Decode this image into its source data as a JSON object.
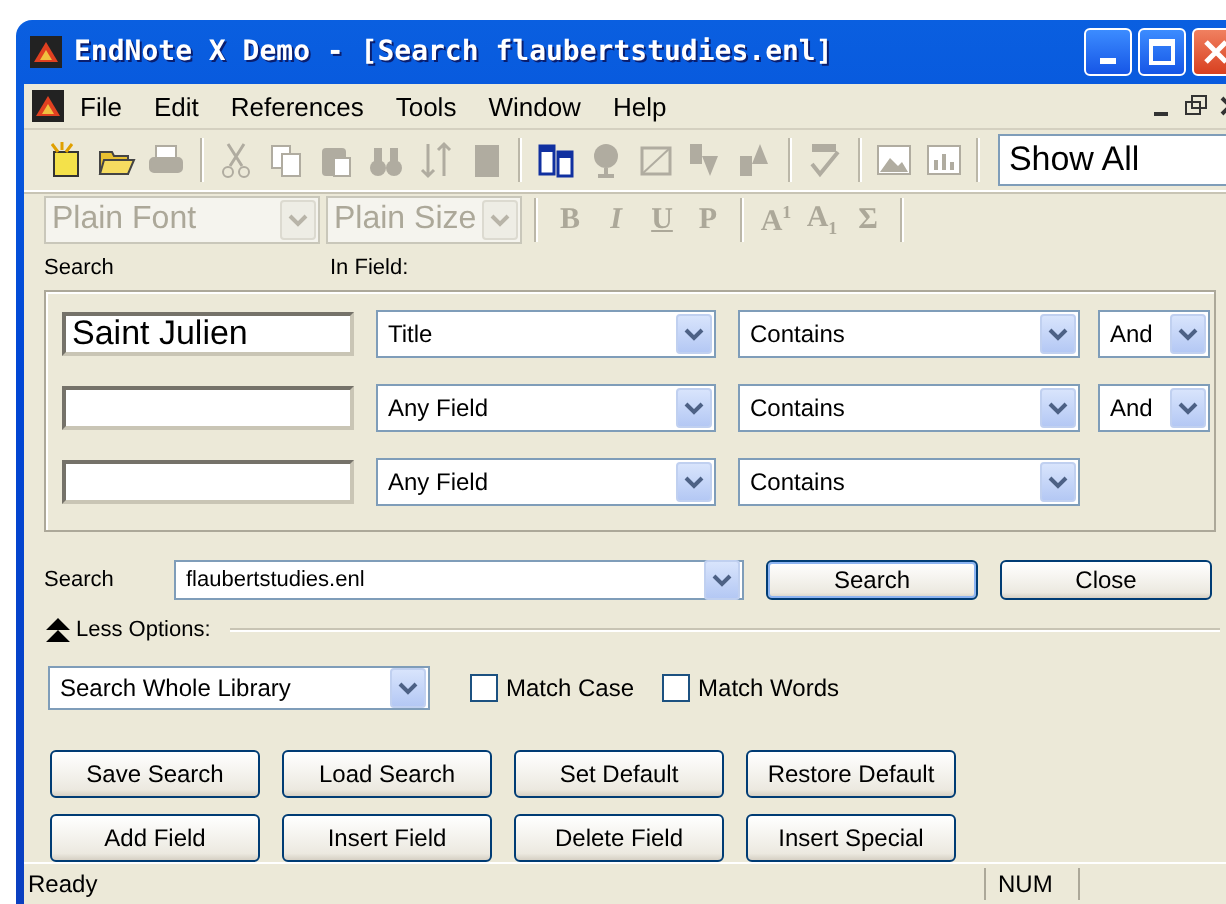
{
  "window": {
    "title": "EndNote X Demo  - [Search flaubertstudies.enl]"
  },
  "menu": [
    "File",
    "Edit",
    "References",
    "Tools",
    "Window",
    "Help"
  ],
  "toolbar": [
    {
      "kind": "new",
      "disabled": false
    },
    {
      "kind": "open",
      "disabled": false
    },
    {
      "kind": "print",
      "disabled": true
    },
    {
      "kind": "separator"
    },
    {
      "kind": "cut",
      "disabled": true
    },
    {
      "kind": "copy",
      "disabled": true
    },
    {
      "kind": "paste",
      "disabled": true
    },
    {
      "kind": "find",
      "disabled": true
    },
    {
      "kind": "sort",
      "disabled": true
    },
    {
      "kind": "document",
      "disabled": true
    },
    {
      "kind": "separator"
    },
    {
      "kind": "windows",
      "disabled": false
    },
    {
      "kind": "globe",
      "disabled": true
    },
    {
      "kind": "frame",
      "disabled": true
    },
    {
      "kind": "down",
      "disabled": true
    },
    {
      "kind": "up",
      "disabled": true
    },
    {
      "kind": "separator"
    },
    {
      "kind": "spell",
      "disabled": true
    },
    {
      "kind": "separator"
    },
    {
      "kind": "image",
      "disabled": true
    },
    {
      "kind": "chart",
      "disabled": true
    },
    {
      "kind": "separator"
    }
  ],
  "view_filter": "Show All",
  "format_bar": {
    "font": "Plain Font",
    "size": "Plain Size",
    "disabled": true,
    "buttons": [
      "B",
      "I",
      "U",
      "P",
      "A$^{1}$",
      "A$_{1}$",
      "Σ"
    ]
  },
  "labels": {
    "search": "Search",
    "in_field": "In Field:"
  },
  "criteria": [
    {
      "text": "Saint Julien",
      "field": "Title",
      "operator": "Contains",
      "connector": "And"
    },
    {
      "field": "Any Field",
      "operator": "Contains",
      "connector": "And"
    },
    {
      "field": "Any Field",
      "operator": "Contains"
    }
  ],
  "search_in": {
    "label": "Search",
    "library": "flaubertstudies.enl"
  },
  "actions": [
    "Search",
    "Close"
  ],
  "options_toggle": {
    "label": "Less Options:",
    "expanded": true
  },
  "scope": "Search Whole Library",
  "checks": [
    {
      "label": "Match Case",
      "checked": false
    },
    {
      "label": "Match Words",
      "checked": false
    }
  ],
  "buttons": [
    [
      "Save Search",
      "Load Search",
      "Set Default",
      "Restore Default"
    ],
    [
      "Add Field",
      "Insert Field",
      "Delete Field",
      "Insert Special"
    ]
  ],
  "status_bar": {
    "message": "Ready",
    "num": "NUM"
  }
}
